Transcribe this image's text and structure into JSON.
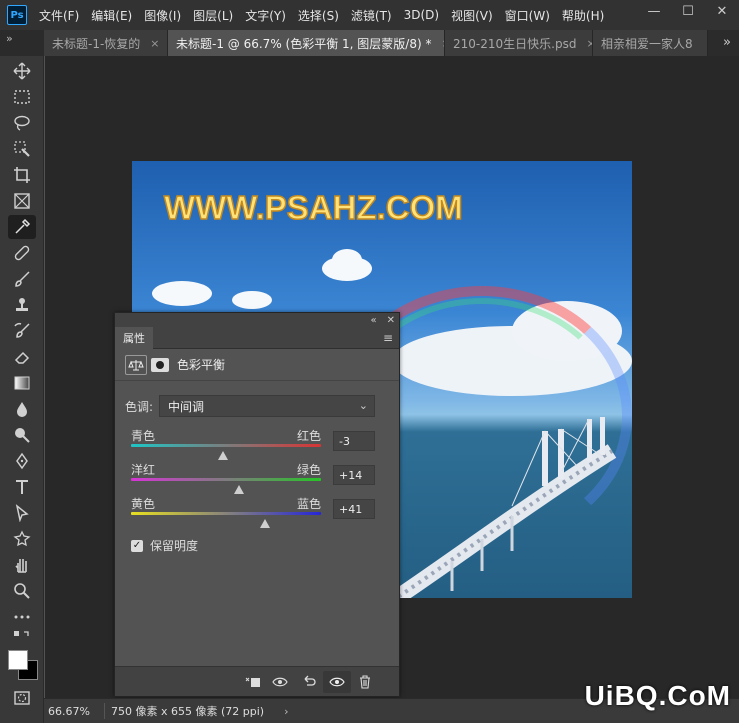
{
  "app": {
    "logo": "Ps"
  },
  "menu": [
    "文件(F)",
    "编辑(E)",
    "图像(I)",
    "图层(L)",
    "文字(Y)",
    "选择(S)",
    "滤镜(T)",
    "3D(D)",
    "视图(V)",
    "窗口(W)",
    "帮助(H)"
  ],
  "window_controls": {
    "minimize": "—",
    "maximize": "☐",
    "close": "✕"
  },
  "tabs": [
    {
      "label": "未标题-1-恢复的",
      "close": "×"
    },
    {
      "label": "未标题-1 @ 66.7% (色彩平衡 1, 图层蒙版/8) *",
      "close": "×",
      "active": true
    },
    {
      "label": "210-210生日快乐.psd",
      "close": "×"
    },
    {
      "label": "相亲相爱一家人8",
      "close": ""
    }
  ],
  "tab_overflow": "»",
  "toolbar_collapse": "»",
  "tools": [
    "move-tool",
    "marquee-tool",
    "lasso-tool",
    "quick-select-tool",
    "crop-tool",
    "frame-tool",
    "eyedropper-tool",
    "healing-tool",
    "brush-tool",
    "stamp-tool",
    "history-brush-tool",
    "eraser-tool",
    "gradient-tool",
    "blur-tool",
    "dodge-tool",
    "pen-tool",
    "type-tool",
    "path-select-tool",
    "shape-tool",
    "hand-tool",
    "zoom-tool",
    "more-tools"
  ],
  "canvas": {
    "watermark": "WWW.PSAHZ.COM"
  },
  "properties_panel": {
    "collapse_label": "«",
    "close_label": "✕",
    "tab_label": "属性",
    "menu_icon": "≡",
    "adjustment_name": "色彩平衡",
    "tone_label": "色调:",
    "tone_value": "中间调",
    "sliders": [
      {
        "left": "青色",
        "right": "红色",
        "value": "-3",
        "value_num": -3,
        "colors": [
          "#1ec6c6",
          "#d83434"
        ]
      },
      {
        "left": "洋红",
        "right": "绿色",
        "value": "+14",
        "value_num": 14,
        "colors": [
          "#d634d6",
          "#26c426"
        ]
      },
      {
        "left": "黄色",
        "right": "蓝色",
        "value": "+41",
        "value_num": 41,
        "colors": [
          "#e8e020",
          "#2626d8"
        ]
      }
    ],
    "preserve_luminosity": "保留明度",
    "preserve_checked": true
  },
  "status": {
    "zoom": "66.67%",
    "dims": "750 像素 x 655 像素 (72 ppi)",
    "arrow": "›"
  },
  "site_watermark": "UiBQ.CoM"
}
